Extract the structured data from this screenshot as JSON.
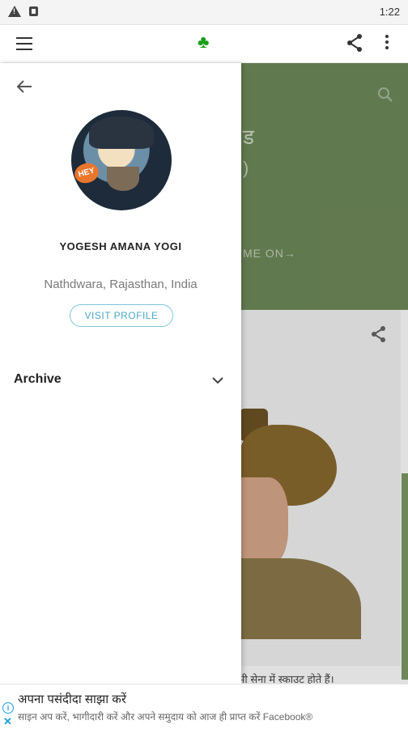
{
  "status_bar": {
    "time": "1:22",
    "icons": [
      "warning-icon",
      "notification-square-icon"
    ]
  },
  "app_bar": {
    "menu_icon": "hamburger-menu-icon",
    "logo_icon": "club-suit-icon",
    "logo_glyph": "♣",
    "share_icon": "share-icon",
    "more_icon": "more-vertical-icon",
    "logo_color": "#1a9e1a"
  },
  "background": {
    "hero_color": "#6f8a5b",
    "title_fragment": "ड",
    "readmore_fragment": "ME ON→",
    "caption_fragment": "ज भी सेना में स्काउट होते हैं।"
  },
  "drawer": {
    "back_icon": "arrow-back-icon",
    "avatar_badge": "HEY",
    "profile_name": "YOGESH AMANA YOGI",
    "location": "Nathdwara, Rajasthan, India",
    "visit_profile_label": "VISIT PROFILE",
    "archive_label": "Archive",
    "archive_icon": "chevron-down-icon",
    "accent_color": "#4aa8c3"
  },
  "ad": {
    "info_icon": "ad-info-icon",
    "info_glyph": "i",
    "close_icon": "ad-close-icon",
    "close_glyph": "✕",
    "title": "अपना पसंदीदा साझा करें",
    "subtitle": "साइन अप करें, भागीदारी करें और अपने समुदाय को आज ही प्राप्त करें Facebook®"
  }
}
